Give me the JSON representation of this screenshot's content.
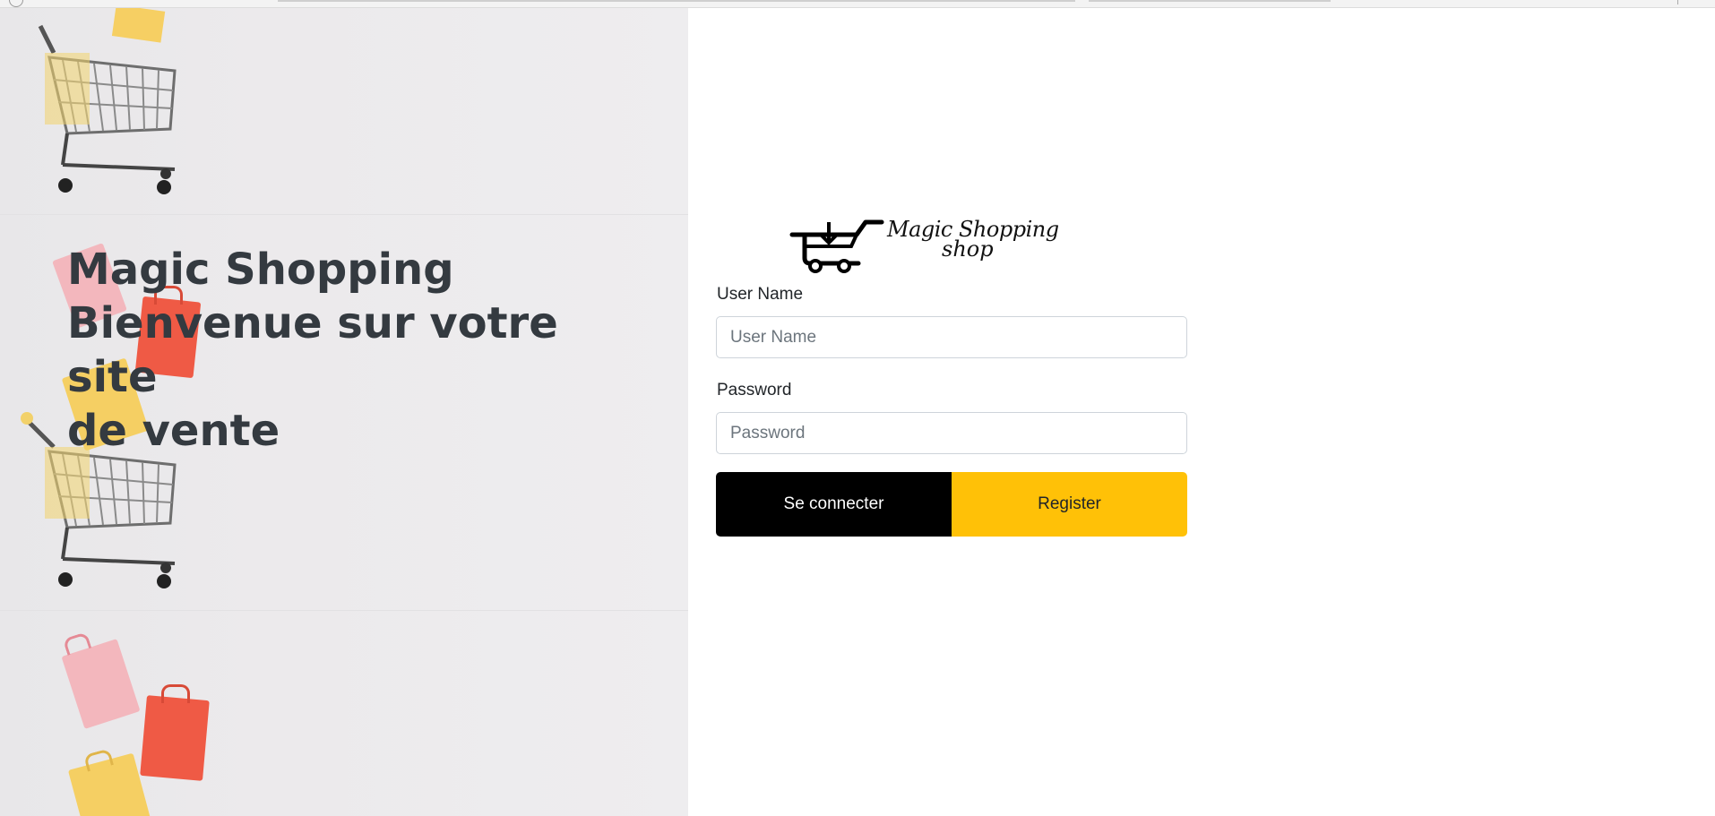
{
  "hero": {
    "title_line1": "Magic Shopping",
    "title_line2": "Bienvenue sur votre site",
    "title_line3": "de vente"
  },
  "logo": {
    "text_line1": "Magic Shopping",
    "text_line2": "shop"
  },
  "form": {
    "username_label": "User Name",
    "username_placeholder": "User Name",
    "password_label": "Password",
    "password_placeholder": "Password",
    "login_button": "Se connecter",
    "register_button": "Register"
  },
  "colors": {
    "login_button_bg": "#000000",
    "register_button_bg": "#ffc107",
    "title_color": "#343a40"
  }
}
